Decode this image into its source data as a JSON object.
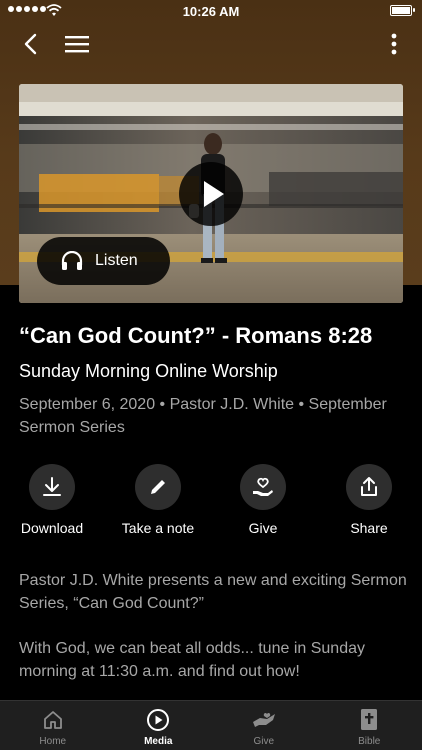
{
  "status_bar": {
    "time": "10:26 AM"
  },
  "nav": {
    "back_icon": "chevron-left-icon",
    "menu_icon": "hamburger-menu-icon",
    "more_icon": "more-vertical-icon"
  },
  "video": {
    "play_icon": "play-icon",
    "listen_label": "Listen",
    "listen_icon": "headphones-icon"
  },
  "sermon": {
    "title": "“Can God Count?” - Romans 8:28",
    "subtitle": "Sunday Morning Online Worship",
    "meta": "September 6, 2020 • Pastor J.D. White • September Sermon Series"
  },
  "actions": [
    {
      "label": "Download",
      "icon": "download-icon"
    },
    {
      "label": "Take a note",
      "icon": "pencil-icon"
    },
    {
      "label": "Give",
      "icon": "give-hand-heart-icon"
    },
    {
      "label": "Share",
      "icon": "share-icon"
    }
  ],
  "description": {
    "p1": "Pastor J.D. White presents a new and exciting Sermon Series, “Can God Count?”",
    "p2": "With God, we can beat all odds... tune in Sunday morning at 11:30 a.m. and find out how!"
  },
  "tabs": [
    {
      "label": "Home",
      "icon": "home-icon",
      "active": false
    },
    {
      "label": "Media",
      "icon": "play-circle-icon",
      "active": true
    },
    {
      "label": "Give",
      "icon": "give-icon",
      "active": false
    },
    {
      "label": "Bible",
      "icon": "bible-icon",
      "active": false
    }
  ],
  "colors": {
    "header_brown": "#573a1a",
    "background": "#000000",
    "muted_text": "#a7a7a7",
    "action_circle": "#2e2e2e",
    "tab_bar": "#1f1f1f"
  }
}
